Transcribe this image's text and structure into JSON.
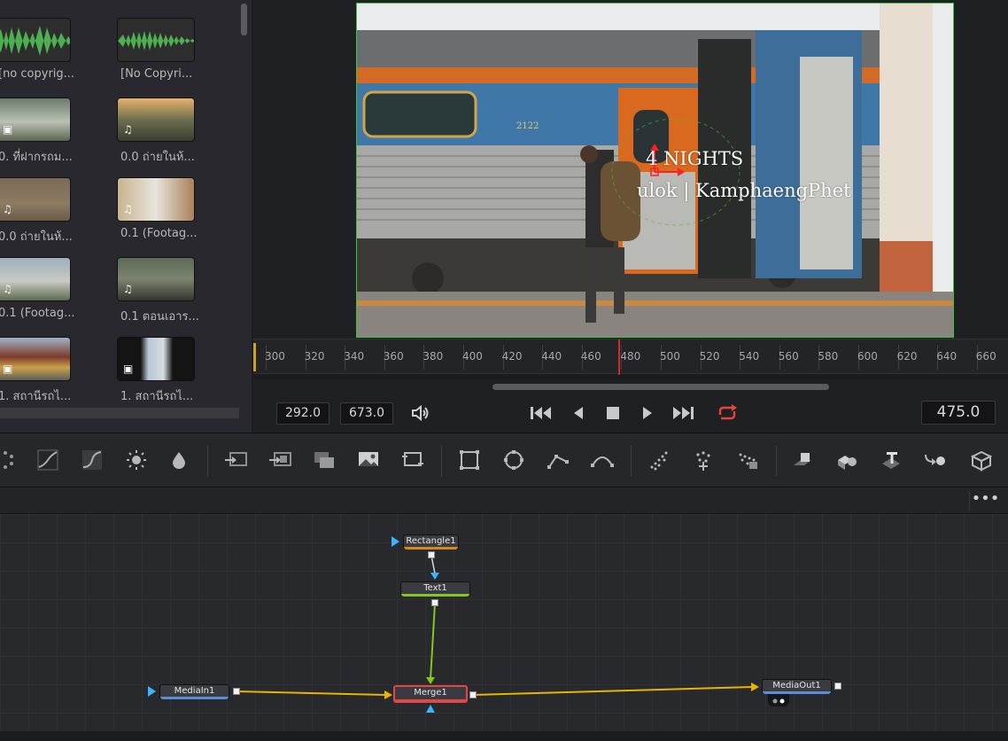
{
  "media_pool": {
    "clips": [
      {
        "label": "[no copyrig..."
      },
      {
        "label": "[No Copyri..."
      },
      {
        "label": "0. ที่ฝากรถม..."
      },
      {
        "label": "0.0 ถ่ายในห้..."
      },
      {
        "label": "0.0 ถ่ายในห้..."
      },
      {
        "label": "0.1 (Footag..."
      },
      {
        "label": "0.1 (Footag..."
      },
      {
        "label": "0.1 ตอนเอาร..."
      },
      {
        "label": "1. สถานีรถไ..."
      },
      {
        "label": "1. สถานีรถไ..."
      }
    ]
  },
  "viewer": {
    "overlay_line1": "4 NIGHTS",
    "overlay_line2": "ulok | KamphaengPhet",
    "train_number": "2122"
  },
  "ruler": {
    "ticks": [
      "300",
      "320",
      "340",
      "360",
      "380",
      "400",
      "420",
      "440",
      "460",
      "480",
      "500",
      "520",
      "540",
      "560",
      "580",
      "600",
      "620",
      "640",
      "660"
    ]
  },
  "transport": {
    "in_point": "292.0",
    "out_point": "673.0",
    "current_frame": "475.0"
  },
  "nodes": {
    "rectangle": "Rectangle1",
    "text": "Text1",
    "merge": "Merge1",
    "media_in": "MediaIn1",
    "media_out": "MediaOut1"
  },
  "colors": {
    "accent_red": "#d02c2c",
    "viewer_border": "#3ac43a",
    "link_yellow": "#e8b400",
    "link_green": "#86c81a"
  }
}
